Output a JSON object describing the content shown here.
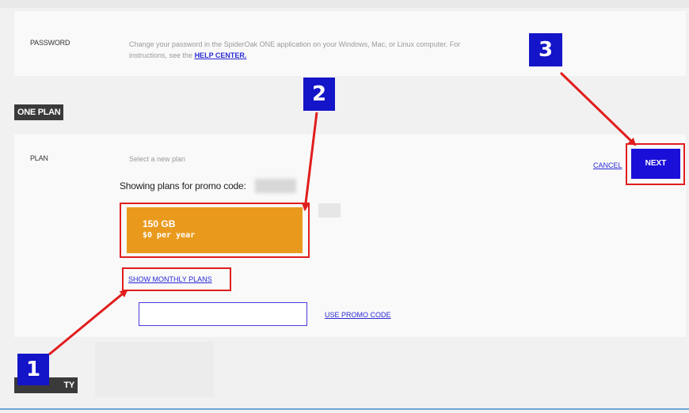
{
  "password_section": {
    "label": "PASSWORD",
    "description": "Change your password in the SpiderOak ONE application on your Windows, Mac, or Linux computer. For instructions, see the",
    "help_link": "HELP CENTER."
  },
  "plan_section": {
    "tag": "ONE PLAN",
    "label": "PLAN",
    "select_text": "Select a new plan",
    "promo_text": "Showing plans for promo code:",
    "plan_card": {
      "size": "150 GB",
      "price": "$0 per year"
    },
    "show_monthly": "SHOW MONTHLY PLANS",
    "promo_input_value": "",
    "use_promo": "USE PROMO CODE",
    "cancel": "CANCEL",
    "next": "NEXT"
  },
  "security_section": {
    "tag_visible_part": "TY"
  },
  "annotations": {
    "badge1": "1",
    "badge2": "2",
    "badge3": "3",
    "arrow_color": "#e11d1d",
    "badge_color": "#1414c8"
  }
}
